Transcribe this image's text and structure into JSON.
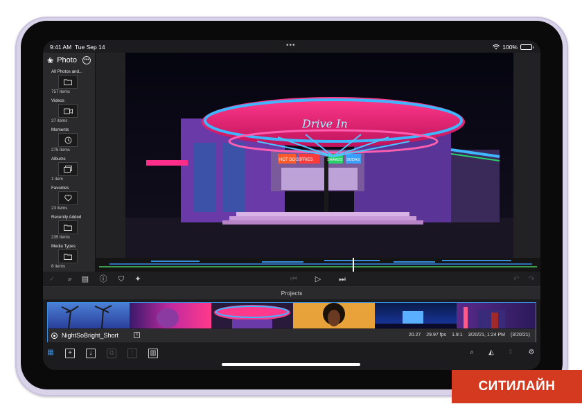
{
  "status_bar": {
    "time": "9:41 AM",
    "date": "Tue Sep 14",
    "battery": "100%"
  },
  "sidebar": {
    "title": "Photo",
    "items": [
      {
        "label": "All Photos and...",
        "count": "757 items",
        "icon": "folder-icon"
      },
      {
        "label": "Videos",
        "count": "27 items",
        "icon": "video-camera-icon"
      },
      {
        "label": "Moments",
        "count": "275 items",
        "icon": "clock-icon"
      },
      {
        "label": "Albums",
        "count": "1 item",
        "icon": "albums-icon"
      },
      {
        "label": "Favorites",
        "count": "23 items",
        "icon": "heart-icon"
      },
      {
        "label": "Recently Added",
        "count": "235 items",
        "icon": "folder-icon"
      },
      {
        "label": "Media Types",
        "count": "6 items",
        "icon": "folder-icon"
      }
    ]
  },
  "preview": {
    "signs": {
      "main": "Drive In",
      "left_window": "HOT DOGS",
      "mid_window": "FRIES",
      "right_window": "SODAS",
      "shakes": "SHAKES"
    }
  },
  "projects": {
    "header": "Projects",
    "items": [
      {
        "name": "NightSoBright_Short",
        "duration": "20.27",
        "fps": "29.97 fps",
        "aspect": "1.9:1",
        "date": "3/20/21, 1:24 PM",
        "created": "(3/20/21)"
      }
    ]
  },
  "brand": {
    "text": "СИТИЛАЙН"
  },
  "colors": {
    "accent": "#3a8ee0",
    "brand": "#d43a1f",
    "neon_pink": "#ff2d8a",
    "neon_blue": "#3fb6ff"
  }
}
